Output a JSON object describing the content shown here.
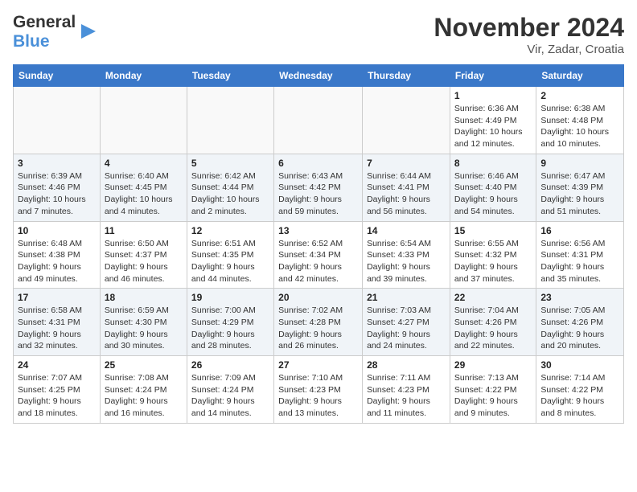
{
  "logo": {
    "line1": "General",
    "line2": "Blue"
  },
  "header": {
    "month": "November 2024",
    "location": "Vir, Zadar, Croatia"
  },
  "weekdays": [
    "Sunday",
    "Monday",
    "Tuesday",
    "Wednesday",
    "Thursday",
    "Friday",
    "Saturday"
  ],
  "weeks": [
    [
      {
        "day": "",
        "info": ""
      },
      {
        "day": "",
        "info": ""
      },
      {
        "day": "",
        "info": ""
      },
      {
        "day": "",
        "info": ""
      },
      {
        "day": "",
        "info": ""
      },
      {
        "day": "1",
        "info": "Sunrise: 6:36 AM\nSunset: 4:49 PM\nDaylight: 10 hours and 12 minutes."
      },
      {
        "day": "2",
        "info": "Sunrise: 6:38 AM\nSunset: 4:48 PM\nDaylight: 10 hours and 10 minutes."
      }
    ],
    [
      {
        "day": "3",
        "info": "Sunrise: 6:39 AM\nSunset: 4:46 PM\nDaylight: 10 hours and 7 minutes."
      },
      {
        "day": "4",
        "info": "Sunrise: 6:40 AM\nSunset: 4:45 PM\nDaylight: 10 hours and 4 minutes."
      },
      {
        "day": "5",
        "info": "Sunrise: 6:42 AM\nSunset: 4:44 PM\nDaylight: 10 hours and 2 minutes."
      },
      {
        "day": "6",
        "info": "Sunrise: 6:43 AM\nSunset: 4:42 PM\nDaylight: 9 hours and 59 minutes."
      },
      {
        "day": "7",
        "info": "Sunrise: 6:44 AM\nSunset: 4:41 PM\nDaylight: 9 hours and 56 minutes."
      },
      {
        "day": "8",
        "info": "Sunrise: 6:46 AM\nSunset: 4:40 PM\nDaylight: 9 hours and 54 minutes."
      },
      {
        "day": "9",
        "info": "Sunrise: 6:47 AM\nSunset: 4:39 PM\nDaylight: 9 hours and 51 minutes."
      }
    ],
    [
      {
        "day": "10",
        "info": "Sunrise: 6:48 AM\nSunset: 4:38 PM\nDaylight: 9 hours and 49 minutes."
      },
      {
        "day": "11",
        "info": "Sunrise: 6:50 AM\nSunset: 4:37 PM\nDaylight: 9 hours and 46 minutes."
      },
      {
        "day": "12",
        "info": "Sunrise: 6:51 AM\nSunset: 4:35 PM\nDaylight: 9 hours and 44 minutes."
      },
      {
        "day": "13",
        "info": "Sunrise: 6:52 AM\nSunset: 4:34 PM\nDaylight: 9 hours and 42 minutes."
      },
      {
        "day": "14",
        "info": "Sunrise: 6:54 AM\nSunset: 4:33 PM\nDaylight: 9 hours and 39 minutes."
      },
      {
        "day": "15",
        "info": "Sunrise: 6:55 AM\nSunset: 4:32 PM\nDaylight: 9 hours and 37 minutes."
      },
      {
        "day": "16",
        "info": "Sunrise: 6:56 AM\nSunset: 4:31 PM\nDaylight: 9 hours and 35 minutes."
      }
    ],
    [
      {
        "day": "17",
        "info": "Sunrise: 6:58 AM\nSunset: 4:31 PM\nDaylight: 9 hours and 32 minutes."
      },
      {
        "day": "18",
        "info": "Sunrise: 6:59 AM\nSunset: 4:30 PM\nDaylight: 9 hours and 30 minutes."
      },
      {
        "day": "19",
        "info": "Sunrise: 7:00 AM\nSunset: 4:29 PM\nDaylight: 9 hours and 28 minutes."
      },
      {
        "day": "20",
        "info": "Sunrise: 7:02 AM\nSunset: 4:28 PM\nDaylight: 9 hours and 26 minutes."
      },
      {
        "day": "21",
        "info": "Sunrise: 7:03 AM\nSunset: 4:27 PM\nDaylight: 9 hours and 24 minutes."
      },
      {
        "day": "22",
        "info": "Sunrise: 7:04 AM\nSunset: 4:26 PM\nDaylight: 9 hours and 22 minutes."
      },
      {
        "day": "23",
        "info": "Sunrise: 7:05 AM\nSunset: 4:26 PM\nDaylight: 9 hours and 20 minutes."
      }
    ],
    [
      {
        "day": "24",
        "info": "Sunrise: 7:07 AM\nSunset: 4:25 PM\nDaylight: 9 hours and 18 minutes."
      },
      {
        "day": "25",
        "info": "Sunrise: 7:08 AM\nSunset: 4:24 PM\nDaylight: 9 hours and 16 minutes."
      },
      {
        "day": "26",
        "info": "Sunrise: 7:09 AM\nSunset: 4:24 PM\nDaylight: 9 hours and 14 minutes."
      },
      {
        "day": "27",
        "info": "Sunrise: 7:10 AM\nSunset: 4:23 PM\nDaylight: 9 hours and 13 minutes."
      },
      {
        "day": "28",
        "info": "Sunrise: 7:11 AM\nSunset: 4:23 PM\nDaylight: 9 hours and 11 minutes."
      },
      {
        "day": "29",
        "info": "Sunrise: 7:13 AM\nSunset: 4:22 PM\nDaylight: 9 hours and 9 minutes."
      },
      {
        "day": "30",
        "info": "Sunrise: 7:14 AM\nSunset: 4:22 PM\nDaylight: 9 hours and 8 minutes."
      }
    ]
  ]
}
